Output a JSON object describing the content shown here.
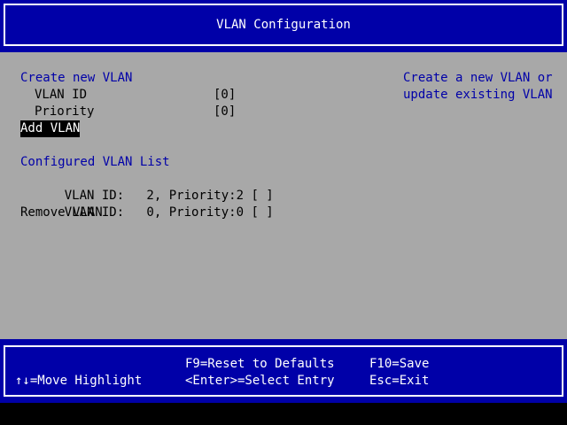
{
  "header": {
    "title": "VLAN Configuration"
  },
  "create_section": {
    "heading": "Create new VLAN",
    "fields": [
      {
        "label": "VLAN ID",
        "value": "[0]"
      },
      {
        "label": "Priority",
        "value": "[0]"
      }
    ],
    "add_action": "Add VLAN"
  },
  "configured_section": {
    "heading": "Configured VLAN List",
    "entries": [
      {
        "text": "VLAN ID:   2, Priority:2",
        "checkbox": "[ ]"
      },
      {
        "text": "VLAN ID:   0, Priority:0",
        "checkbox": "[ ]"
      }
    ],
    "remove_action": "Remove VLAN"
  },
  "help": {
    "line1": "Create a new VLAN or",
    "line2": "update existing VLAN"
  },
  "footer": {
    "move_highlight": "↑↓=Move Highlight",
    "reset": "F9=Reset to Defaults",
    "select": "<Enter>=Select Entry",
    "save": "F10=Save",
    "exit": "Esc=Exit"
  },
  "colors": {
    "blue": "#0000a8",
    "gray": "#a8a8a8",
    "navy_text": "#0000a8",
    "white": "#ffffff",
    "black": "#000000"
  }
}
